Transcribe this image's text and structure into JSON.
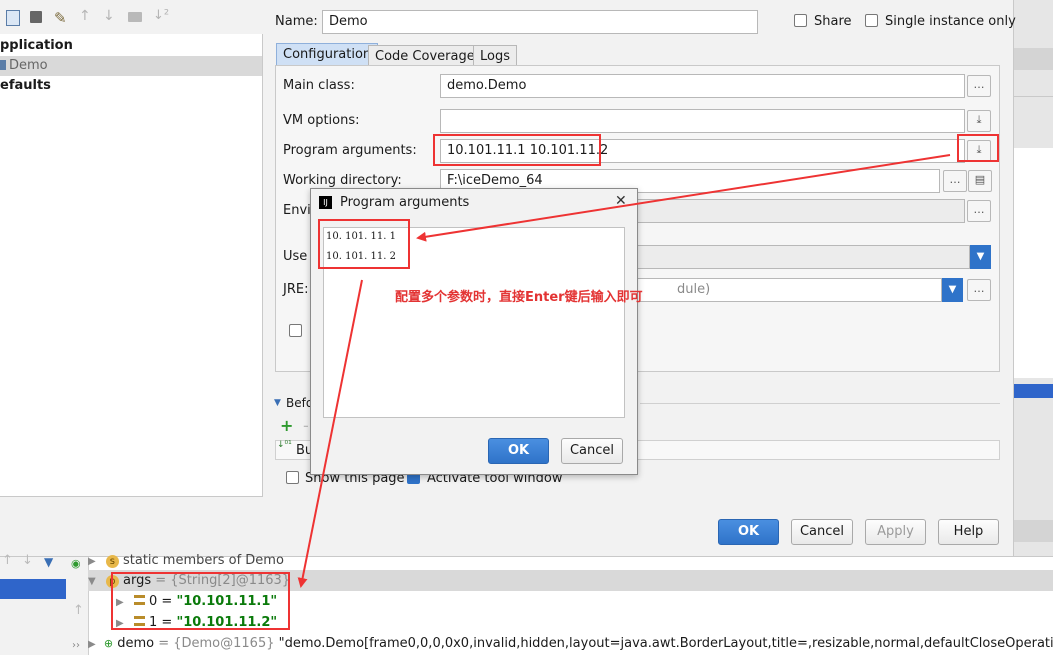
{
  "left_panel": {
    "items": [
      {
        "label": "pplication",
        "selected": false,
        "bold": true
      },
      {
        "label": "Demo",
        "selected": true,
        "bold": false
      },
      {
        "label": "efaults",
        "selected": false,
        "bold": true
      }
    ]
  },
  "header": {
    "name_label": "Name:",
    "name_value": "Demo",
    "share_label": "Share",
    "single_instance_label": "Single instance only"
  },
  "tabs": [
    {
      "label": "Configuration",
      "active": true
    },
    {
      "label": "Code Coverage",
      "active": false
    },
    {
      "label": "Logs",
      "active": false
    }
  ],
  "form": {
    "main_class_label": "Main class:",
    "main_class_value": "demo.Demo",
    "vm_options_label": "VM options:",
    "vm_options_value": "",
    "program_args_label": "Program arguments:",
    "program_args_value": "10.101.11.1 10.101.11.2",
    "working_dir_label": "Working directory:",
    "working_dir_value": "F:\\iceDemo_64",
    "env_label": "Envir",
    "use_label": "Use",
    "jre_label": "JRE:",
    "jre_value": "dule)",
    "before_label": "Befo",
    "build_label": "Bu",
    "show_page_label": "Show this page",
    "activate_label": "Activate tool window"
  },
  "footer_buttons": {
    "ok": "OK",
    "cancel": "Cancel",
    "apply": "Apply",
    "help": "Help"
  },
  "popup": {
    "title": "Program arguments",
    "lines": [
      "10. 101. 11. 1",
      "10. 101. 11. 2"
    ],
    "ok": "OK",
    "cancel": "Cancel"
  },
  "annotation": {
    "text": "配置多个参数时，直接Enter键后输入即可",
    "color": "#e33333"
  },
  "debugger": {
    "rows": [
      {
        "badge": "s",
        "text": "static members of Demo"
      },
      {
        "badge": "p",
        "name": "args",
        "value": "= {String[2]@1163}"
      },
      {
        "name": "0",
        "value": "\"10.101.11.1\""
      },
      {
        "name": "1",
        "value": "\"10.101.11.2\""
      },
      {
        "name": "demo",
        "ref": "= {Demo@1165}",
        "value": "\"demo.Demo[frame0,0,0,0x0,invalid,hidden,layout=java.awt.BorderLayout,title=,resizable,normal,defaultCloseOperation=HIDE_ON_CLO"
      }
    ]
  }
}
